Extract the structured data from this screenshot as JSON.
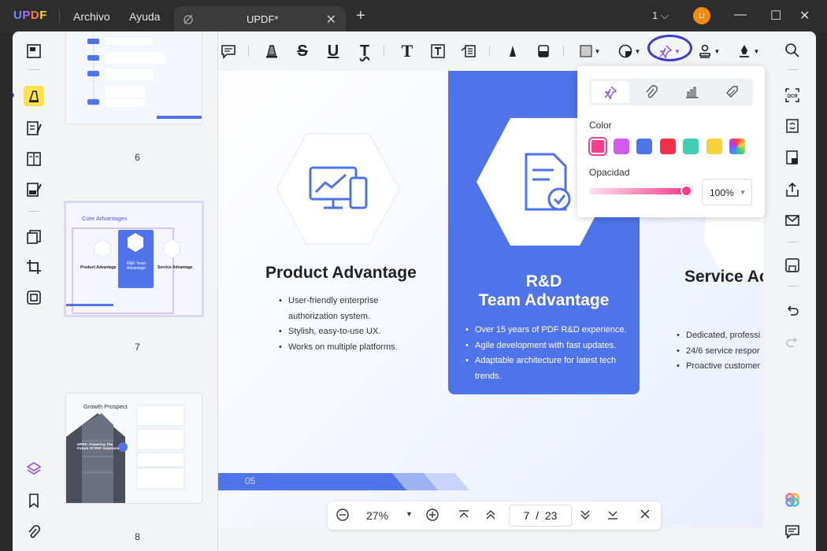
{
  "titlebar": {
    "logo": [
      "U",
      "P",
      "D",
      "F"
    ],
    "menu": [
      "Archivo",
      "Ayuda"
    ],
    "tab_label": "UPDF*",
    "new_tab": "+",
    "page_count": "1",
    "avatar_initials": "LI"
  },
  "thumbnails": [
    {
      "page_label": "6"
    },
    {
      "page_label": "7",
      "heading": "Core Advantages",
      "cards": [
        "Product Advantage",
        "R&D Team Advantage",
        "Service Advantage"
      ]
    },
    {
      "page_label": "8",
      "heading": "Growth Prospect",
      "caption": "UPDF: Powering The Future Of PDF Solutions"
    }
  ],
  "document": {
    "cards": [
      {
        "title": "Product Advantage",
        "bullets": [
          "User-friendly enterprise authorization system.",
          "Stylish, easy-to-use UX.",
          "Works on multiple platforms."
        ]
      },
      {
        "title_line1": "R&D",
        "title_line2": "Team Advantage",
        "bullets": [
          "Over 15 years of PDF R&D experience.",
          "Agile development with fast updates.",
          "Adaptable architecture for latest tech trends."
        ]
      },
      {
        "title": "Service Ac",
        "bullets": [
          "Dedicated, professi",
          "24/6 service respor",
          "Proactive customer"
        ]
      }
    ],
    "page_footer": "05"
  },
  "zoom": {
    "value": "27%",
    "current_page": "7",
    "separator": "/",
    "total_pages": "23"
  },
  "popup": {
    "color_label": "Color",
    "opacity_label": "Opacidad",
    "opacity_value": "100%",
    "colors": [
      "#ff3c8c",
      "#d35cf0",
      "#4f73e8",
      "#f0304c",
      "#3fd0b4",
      "#f8d23c",
      "rainbow"
    ],
    "selected_color": "#ff3c8c",
    "opacity_fraction": 1.0
  },
  "accent": "#4f73e8"
}
